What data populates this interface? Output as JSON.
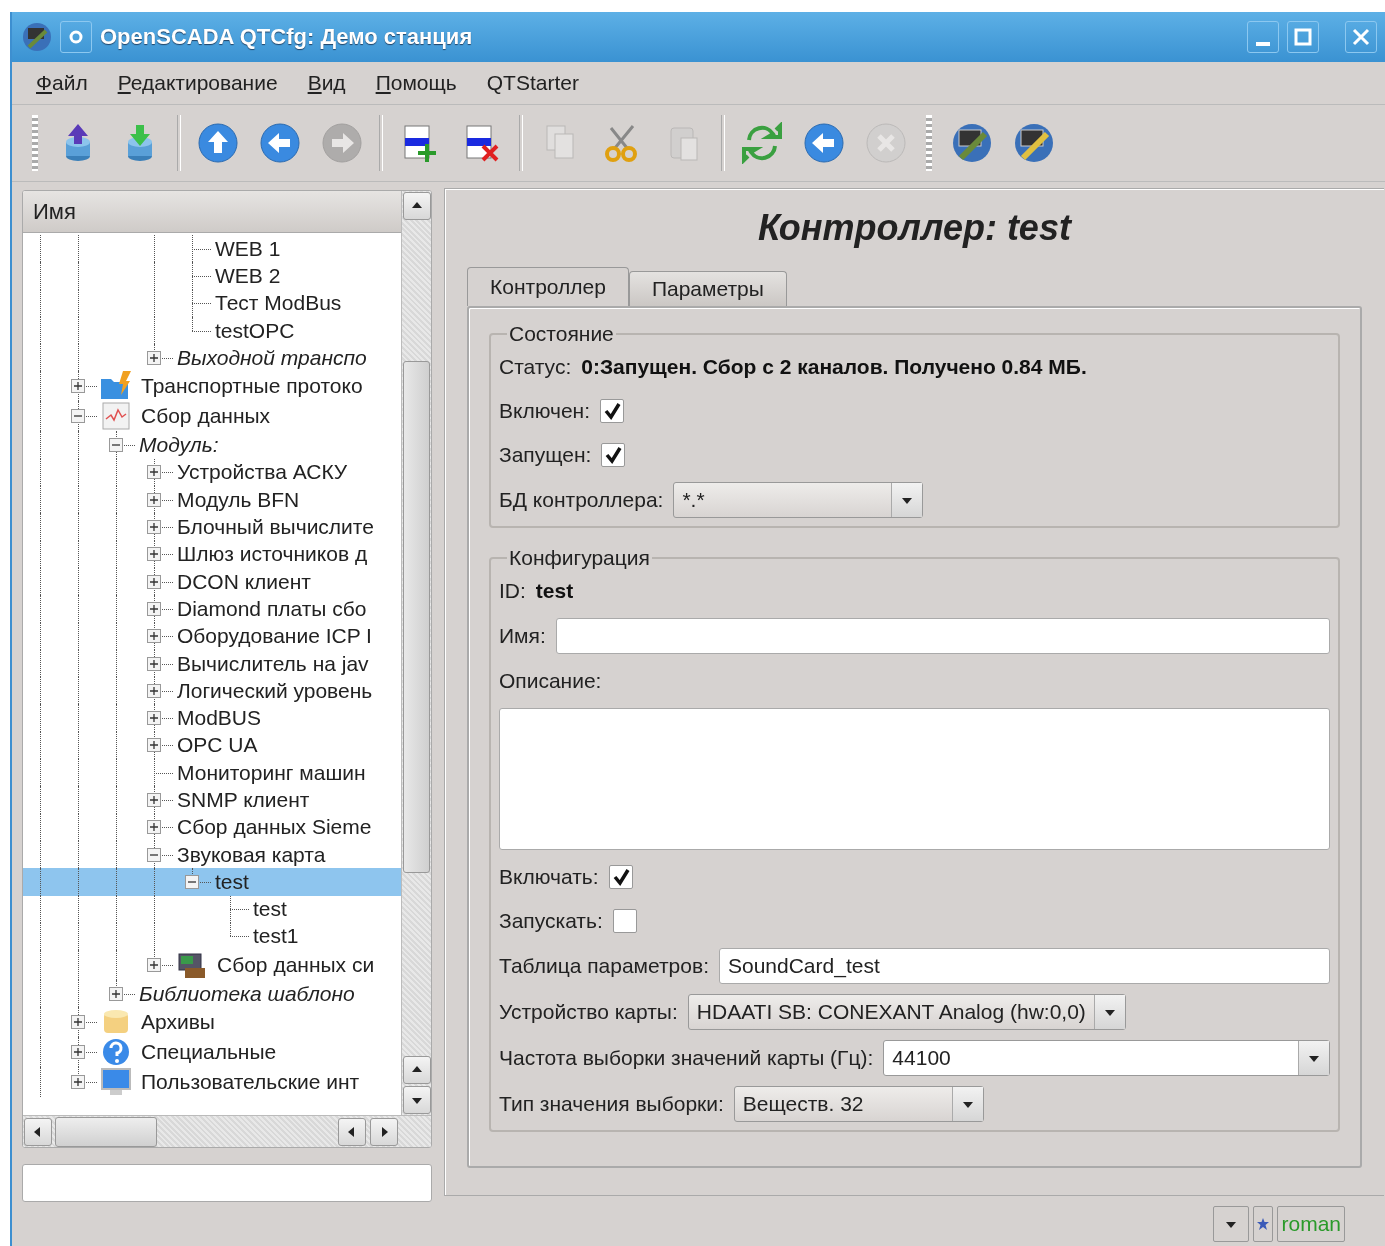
{
  "window": {
    "title": "OpenSCADA QTCfg: Демо станция"
  },
  "menu": [
    {
      "label": "Файл",
      "underline": true
    },
    {
      "label": "Редактирование",
      "underline": true
    },
    {
      "label": "Вид",
      "underline": true
    },
    {
      "label": "Помощь",
      "underline": true
    },
    {
      "label": "QTStarter",
      "underline": false
    }
  ],
  "toolbar": [
    {
      "kind": "db-load",
      "disabled": false
    },
    {
      "kind": "db-save",
      "disabled": false
    },
    {
      "kind": "separator"
    },
    {
      "kind": "up",
      "disabled": false
    },
    {
      "kind": "back",
      "disabled": false
    },
    {
      "kind": "forward",
      "disabled": true
    },
    {
      "kind": "separator"
    },
    {
      "kind": "add-row",
      "disabled": false
    },
    {
      "kind": "delete-row",
      "disabled": false
    },
    {
      "kind": "separator"
    },
    {
      "kind": "copy",
      "disabled": true
    },
    {
      "kind": "cut",
      "disabled": false
    },
    {
      "kind": "paste",
      "disabled": true
    },
    {
      "kind": "separator"
    },
    {
      "kind": "refresh",
      "disabled": false
    },
    {
      "kind": "start",
      "disabled": false
    },
    {
      "kind": "stop",
      "disabled": true
    },
    {
      "kind": "handle"
    },
    {
      "kind": "station",
      "disabled": false
    },
    {
      "kind": "station-edit",
      "disabled": false
    }
  ],
  "tree": {
    "header": "Имя",
    "items": [
      {
        "children": [
          {
            "children": [
              {
                "children": [
                  {
                    "children": [
                      {
                        "label": "WEB 1",
                        "kind": "item",
                        "selected": false
                      },
                      {
                        "label": "WEB 2",
                        "kind": "item",
                        "selected": false
                      },
                      {
                        "label": "Тест ModBus",
                        "kind": "item",
                        "selected": false
                      },
                      {
                        "label": "testOPC",
                        "kind": "item",
                        "selected": false
                      }
                    ]
                  },
                  {
                    "label": "Выходной транспо",
                    "kind": "group",
                    "expanded": false,
                    "selected": false
                  }
                ]
              }
            ]
          },
          {
            "label": "Транспортные протоко",
            "kind": "transport",
            "expanded": false,
            "selected": false
          },
          {
            "label": "Сбор данных",
            "kind": "daq",
            "expanded": true,
            "selected": false,
            "children": [
              {
                "label": "Модуль:",
                "kind": "group",
                "expanded": true,
                "selected": false,
                "children": [
                  {
                    "label": "Устройства АСКУ",
                    "kind": "item",
                    "expanded": false,
                    "selected": false
                  },
                  {
                    "label": "Модуль BFN",
                    "kind": "item",
                    "expanded": false,
                    "selected": false
                  },
                  {
                    "label": "Блочный вычислите",
                    "kind": "item",
                    "expanded": false,
                    "selected": false
                  },
                  {
                    "label": "Шлюз источников д",
                    "kind": "item",
                    "expanded": false,
                    "selected": false
                  },
                  {
                    "label": "DCON клиент",
                    "kind": "item",
                    "expanded": false,
                    "selected": false
                  },
                  {
                    "label": "Diamond платы сбо",
                    "kind": "item",
                    "expanded": false,
                    "selected": false
                  },
                  {
                    "label": "Оборудование ICP I",
                    "kind": "item",
                    "expanded": false,
                    "selected": false
                  },
                  {
                    "label": "Вычислитель на jav",
                    "kind": "item",
                    "expanded": false,
                    "selected": false
                  },
                  {
                    "label": "Логический уровень",
                    "kind": "item",
                    "expanded": false,
                    "selected": false
                  },
                  {
                    "label": "ModBUS",
                    "kind": "item",
                    "expanded": false,
                    "selected": false
                  },
                  {
                    "label": "OPC UA",
                    "kind": "item",
                    "expanded": false,
                    "selected": false
                  },
                  {
                    "label": "Мониторинг машин",
                    "kind": "item",
                    "selected": false
                  },
                  {
                    "label": "SNMP клиент",
                    "kind": "item",
                    "expanded": false,
                    "selected": false
                  },
                  {
                    "label": "Сбор данных Sieme",
                    "kind": "item",
                    "expanded": false,
                    "selected": false
                  },
                  {
                    "label": "Звуковая карта",
                    "kind": "item",
                    "expanded": true,
                    "selected": false,
                    "children": [
                      {
                        "label": "test",
                        "kind": "item",
                        "expanded": true,
                        "selected": true,
                        "children": [
                          {
                            "label": "test",
                            "kind": "item",
                            "selected": false
                          },
                          {
                            "label": "test1",
                            "kind": "item",
                            "selected": false
                          }
                        ]
                      }
                    ]
                  },
                  {
                    "label": "Сбор данных си",
                    "kind": "hardware",
                    "expanded": false,
                    "selected": false
                  }
                ]
              },
              {
                "label": "Библиотека шаблоно",
                "kind": "group",
                "expanded": false,
                "selected": false
              }
            ]
          },
          {
            "label": "Архивы",
            "kind": "archive",
            "expanded": false,
            "selected": false
          },
          {
            "label": "Специальные",
            "kind": "special",
            "expanded": false,
            "selected": false
          },
          {
            "label": "Пользовательские инт",
            "kind": "ui",
            "expanded": false,
            "selected": false
          }
        ]
      }
    ]
  },
  "page": {
    "title": "Контроллер: test",
    "tabs": [
      {
        "label": "Контроллер",
        "selected": true
      },
      {
        "label": "Параметры",
        "selected": false
      }
    ],
    "groups": [
      {
        "title": "Состояние",
        "fields": [
          {
            "kind": "info",
            "label": "Статус:",
            "value": "0:Запущен. Сбор с 2 каналов. Получено 0.84 МБ."
          },
          {
            "kind": "checkbox",
            "label": "Включен:",
            "checked": true
          },
          {
            "kind": "checkbox",
            "label": "Запущен:",
            "checked": true
          },
          {
            "kind": "combo",
            "label": "БД контроллера:",
            "value": "*.*",
            "stretch": false
          }
        ]
      },
      {
        "title": "Конфигурация",
        "fields": [
          {
            "kind": "info",
            "label": "ID:",
            "value": "test"
          },
          {
            "kind": "input",
            "label": "Имя:"
          },
          {
            "kind": "textarea",
            "label": "Описание:"
          },
          {
            "kind": "checkbox",
            "label": "Включать:",
            "checked": true
          },
          {
            "kind": "checkbox",
            "label": "Запускать:",
            "checked": false
          },
          {
            "kind": "input",
            "label": "Таблица параметров:",
            "value": "SoundCard_test"
          },
          {
            "kind": "combo",
            "label": "Устройство карты:",
            "value": "HDAATI SB: CONEXANT Analog (hw:0,0)",
            "stretch": false
          },
          {
            "kind": "combo",
            "label": "Частота выборки значений карты (Гц):",
            "value": "44100",
            "stretch": true
          },
          {
            "kind": "combo",
            "label": "Тип значения выборки:",
            "value": "Веществ. 32",
            "stretch": false
          }
        ]
      }
    ]
  },
  "status_bar": {
    "user": "roman"
  }
}
